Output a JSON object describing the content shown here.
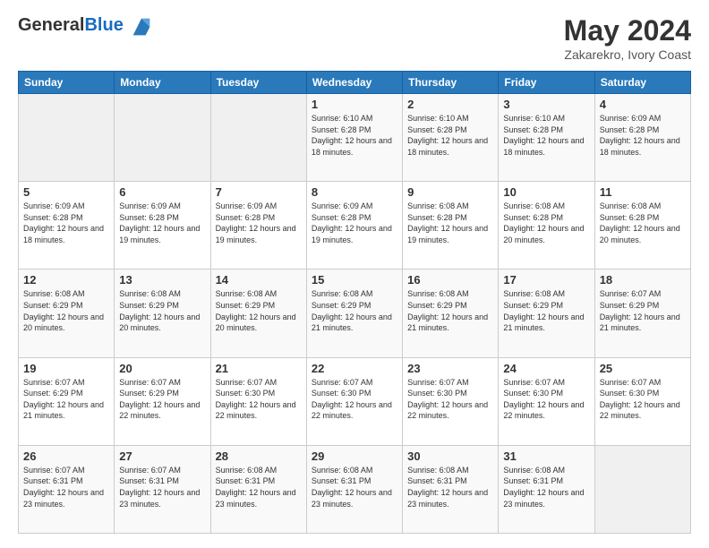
{
  "header": {
    "logo_general": "General",
    "logo_blue": "Blue",
    "title": "May 2024",
    "subtitle": "Zakarekro, Ivory Coast"
  },
  "days_of_week": [
    "Sunday",
    "Monday",
    "Tuesday",
    "Wednesday",
    "Thursday",
    "Friday",
    "Saturday"
  ],
  "weeks": [
    [
      {
        "day": "",
        "info": ""
      },
      {
        "day": "",
        "info": ""
      },
      {
        "day": "",
        "info": ""
      },
      {
        "day": "1",
        "info": "Sunrise: 6:10 AM\nSunset: 6:28 PM\nDaylight: 12 hours and 18 minutes."
      },
      {
        "day": "2",
        "info": "Sunrise: 6:10 AM\nSunset: 6:28 PM\nDaylight: 12 hours and 18 minutes."
      },
      {
        "day": "3",
        "info": "Sunrise: 6:10 AM\nSunset: 6:28 PM\nDaylight: 12 hours and 18 minutes."
      },
      {
        "day": "4",
        "info": "Sunrise: 6:09 AM\nSunset: 6:28 PM\nDaylight: 12 hours and 18 minutes."
      }
    ],
    [
      {
        "day": "5",
        "info": "Sunrise: 6:09 AM\nSunset: 6:28 PM\nDaylight: 12 hours and 18 minutes."
      },
      {
        "day": "6",
        "info": "Sunrise: 6:09 AM\nSunset: 6:28 PM\nDaylight: 12 hours and 19 minutes."
      },
      {
        "day": "7",
        "info": "Sunrise: 6:09 AM\nSunset: 6:28 PM\nDaylight: 12 hours and 19 minutes."
      },
      {
        "day": "8",
        "info": "Sunrise: 6:09 AM\nSunset: 6:28 PM\nDaylight: 12 hours and 19 minutes."
      },
      {
        "day": "9",
        "info": "Sunrise: 6:08 AM\nSunset: 6:28 PM\nDaylight: 12 hours and 19 minutes."
      },
      {
        "day": "10",
        "info": "Sunrise: 6:08 AM\nSunset: 6:28 PM\nDaylight: 12 hours and 20 minutes."
      },
      {
        "day": "11",
        "info": "Sunrise: 6:08 AM\nSunset: 6:28 PM\nDaylight: 12 hours and 20 minutes."
      }
    ],
    [
      {
        "day": "12",
        "info": "Sunrise: 6:08 AM\nSunset: 6:29 PM\nDaylight: 12 hours and 20 minutes."
      },
      {
        "day": "13",
        "info": "Sunrise: 6:08 AM\nSunset: 6:29 PM\nDaylight: 12 hours and 20 minutes."
      },
      {
        "day": "14",
        "info": "Sunrise: 6:08 AM\nSunset: 6:29 PM\nDaylight: 12 hours and 20 minutes."
      },
      {
        "day": "15",
        "info": "Sunrise: 6:08 AM\nSunset: 6:29 PM\nDaylight: 12 hours and 21 minutes."
      },
      {
        "day": "16",
        "info": "Sunrise: 6:08 AM\nSunset: 6:29 PM\nDaylight: 12 hours and 21 minutes."
      },
      {
        "day": "17",
        "info": "Sunrise: 6:08 AM\nSunset: 6:29 PM\nDaylight: 12 hours and 21 minutes."
      },
      {
        "day": "18",
        "info": "Sunrise: 6:07 AM\nSunset: 6:29 PM\nDaylight: 12 hours and 21 minutes."
      }
    ],
    [
      {
        "day": "19",
        "info": "Sunrise: 6:07 AM\nSunset: 6:29 PM\nDaylight: 12 hours and 21 minutes."
      },
      {
        "day": "20",
        "info": "Sunrise: 6:07 AM\nSunset: 6:29 PM\nDaylight: 12 hours and 22 minutes."
      },
      {
        "day": "21",
        "info": "Sunrise: 6:07 AM\nSunset: 6:30 PM\nDaylight: 12 hours and 22 minutes."
      },
      {
        "day": "22",
        "info": "Sunrise: 6:07 AM\nSunset: 6:30 PM\nDaylight: 12 hours and 22 minutes."
      },
      {
        "day": "23",
        "info": "Sunrise: 6:07 AM\nSunset: 6:30 PM\nDaylight: 12 hours and 22 minutes."
      },
      {
        "day": "24",
        "info": "Sunrise: 6:07 AM\nSunset: 6:30 PM\nDaylight: 12 hours and 22 minutes."
      },
      {
        "day": "25",
        "info": "Sunrise: 6:07 AM\nSunset: 6:30 PM\nDaylight: 12 hours and 22 minutes."
      }
    ],
    [
      {
        "day": "26",
        "info": "Sunrise: 6:07 AM\nSunset: 6:31 PM\nDaylight: 12 hours and 23 minutes."
      },
      {
        "day": "27",
        "info": "Sunrise: 6:07 AM\nSunset: 6:31 PM\nDaylight: 12 hours and 23 minutes."
      },
      {
        "day": "28",
        "info": "Sunrise: 6:08 AM\nSunset: 6:31 PM\nDaylight: 12 hours and 23 minutes."
      },
      {
        "day": "29",
        "info": "Sunrise: 6:08 AM\nSunset: 6:31 PM\nDaylight: 12 hours and 23 minutes."
      },
      {
        "day": "30",
        "info": "Sunrise: 6:08 AM\nSunset: 6:31 PM\nDaylight: 12 hours and 23 minutes."
      },
      {
        "day": "31",
        "info": "Sunrise: 6:08 AM\nSunset: 6:31 PM\nDaylight: 12 hours and 23 minutes."
      },
      {
        "day": "",
        "info": ""
      }
    ]
  ]
}
